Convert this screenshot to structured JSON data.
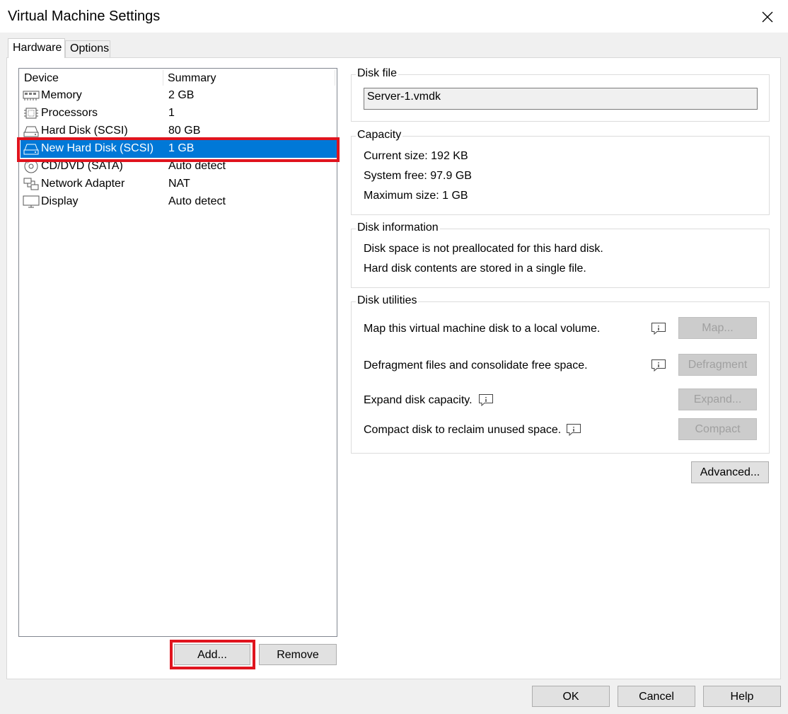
{
  "window": {
    "title": "Virtual Machine Settings"
  },
  "tabs": [
    {
      "label": "Hardware",
      "active": true
    },
    {
      "label": "Options",
      "active": false
    }
  ],
  "device_list": {
    "columns": {
      "device": "Device",
      "summary": "Summary"
    },
    "rows": [
      {
        "name": "Memory",
        "summary": "2 GB",
        "icon": "memory-icon"
      },
      {
        "name": "Processors",
        "summary": "1",
        "icon": "processor-icon"
      },
      {
        "name": "Hard Disk (SCSI)",
        "summary": "80 GB",
        "icon": "hard-disk-icon"
      },
      {
        "name": "New Hard Disk (SCSI)",
        "summary": "1 GB",
        "icon": "hard-disk-icon",
        "selected": true
      },
      {
        "name": "CD/DVD (SATA)",
        "summary": "Auto detect",
        "icon": "cd-dvd-icon"
      },
      {
        "name": "Network Adapter",
        "summary": "NAT",
        "icon": "network-adapter-icon"
      },
      {
        "name": "Display",
        "summary": "Auto detect",
        "icon": "display-icon"
      }
    ],
    "buttons": {
      "add": "Add...",
      "remove": "Remove"
    }
  },
  "disk_file": {
    "title": "Disk file",
    "value": "Server-1.vmdk"
  },
  "capacity": {
    "title": "Capacity",
    "current_size": "Current size: 192 KB",
    "system_free": "System free: 97.9 GB",
    "maximum_size": "Maximum size: 1 GB"
  },
  "disk_information": {
    "title": "Disk information",
    "line1": "Disk space is not preallocated for this hard disk.",
    "line2": "Hard disk contents are stored in a single file."
  },
  "disk_utilities": {
    "title": "Disk utilities",
    "map": {
      "text": "Map this virtual machine disk to a local volume.",
      "button": "Map..."
    },
    "defragment": {
      "text": "Defragment files and consolidate free space.",
      "button": "Defragment"
    },
    "expand": {
      "text": "Expand disk capacity.",
      "button": "Expand..."
    },
    "compact": {
      "text": "Compact disk to reclaim unused space.",
      "button": "Compact"
    }
  },
  "advanced_button": "Advanced...",
  "dialog_buttons": {
    "ok": "OK",
    "cancel": "Cancel",
    "help": "Help"
  },
  "colors": {
    "selection": "#0078d7",
    "highlight": "#e0141e"
  }
}
